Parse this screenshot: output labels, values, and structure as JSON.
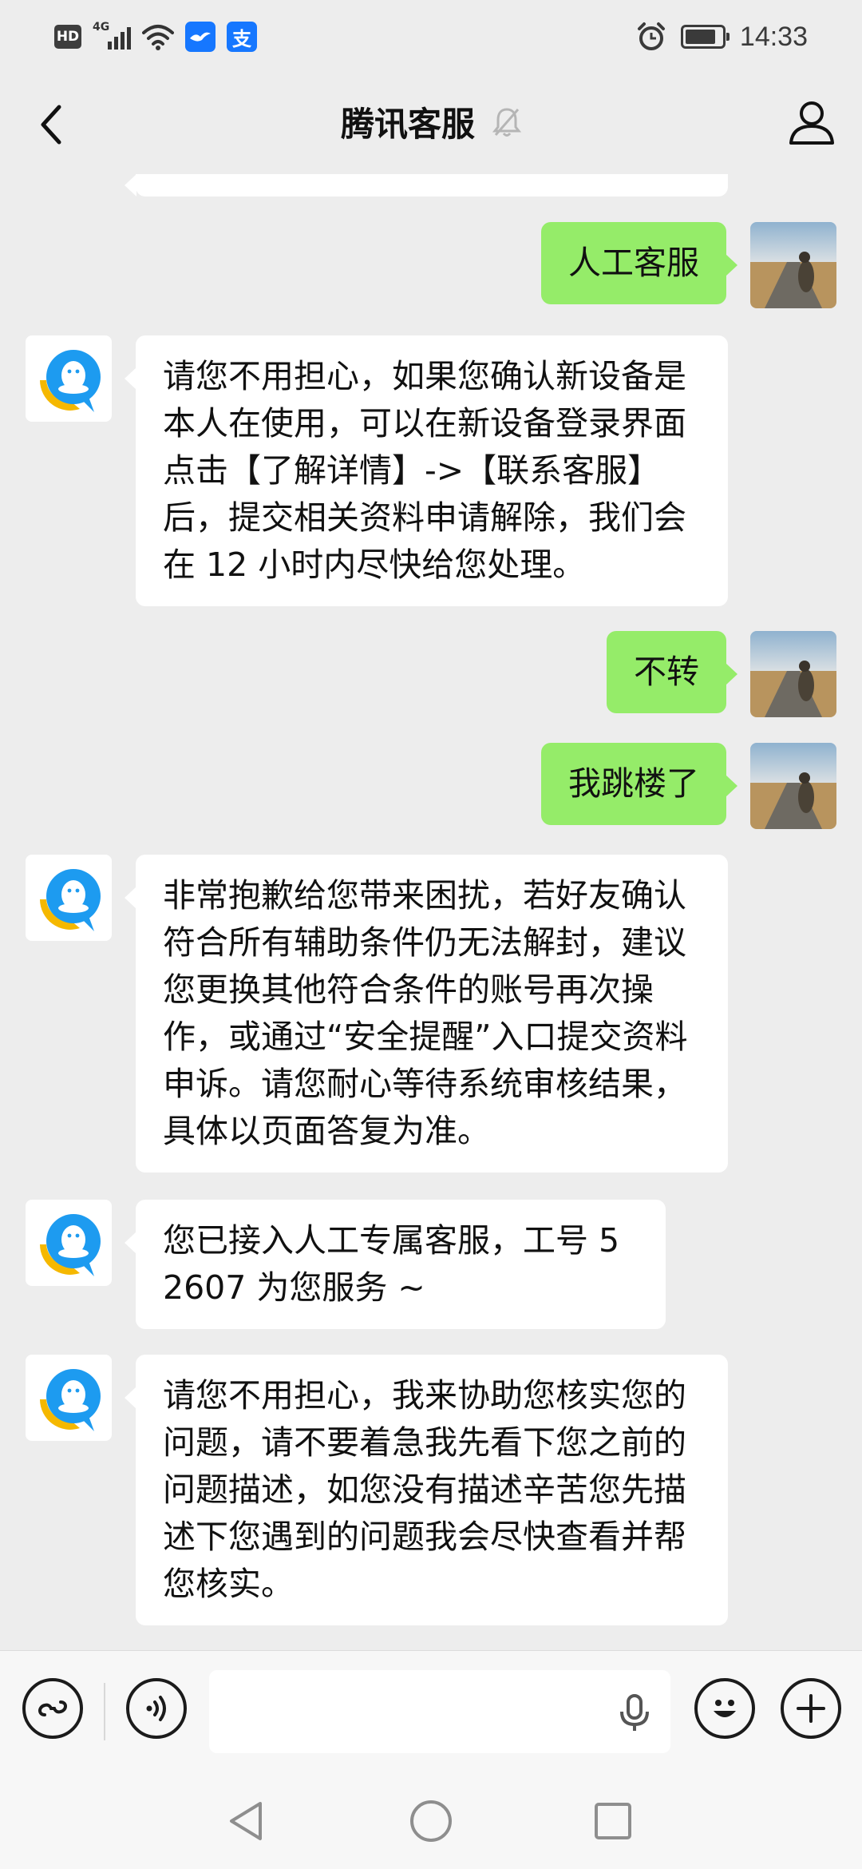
{
  "status_bar": {
    "hd_label": "HD",
    "network_label": "4G",
    "alipay_glyph": "支",
    "time": "14:33",
    "battery_level": 0.85,
    "icons": [
      "hd-icon",
      "signal-icon",
      "wifi-icon",
      "bird-app-icon",
      "alipay-icon",
      "alarm-icon",
      "battery-charging-icon"
    ]
  },
  "header": {
    "title": "腾讯客服",
    "muted": true,
    "icons": [
      "back-icon",
      "mute-bell-icon",
      "profile-icon"
    ]
  },
  "messages": [
    {
      "side": "incoming",
      "text": "",
      "partially_visible": true
    },
    {
      "side": "outgoing",
      "text": "人工客服"
    },
    {
      "side": "incoming",
      "text": "请您不用担心，如果您确认新设备是本人在使用，可以在新设备登录界面点击【了解详情】->【联系客服】后，提交相关资料申请解除，我们会在 12 小时内尽快给您处理。"
    },
    {
      "side": "outgoing",
      "text": "不转"
    },
    {
      "side": "outgoing",
      "text": "我跳楼了"
    },
    {
      "side": "incoming",
      "text": "非常抱歉给您带来困扰，若好友确认符合所有辅助条件仍无法解封，建议您更换其他符合条件的账号再次操作，或通过“安全提醒”入口提交资料申诉。请您耐心等待系统审核结果，具体以页面答复为准。"
    },
    {
      "side": "incoming",
      "text": "您已接入人工专属客服，工号 52607 为您服务 ~"
    },
    {
      "side": "incoming",
      "text": "请您不用担心，我来协助您核实您的问题，请不要着急我先看下您之前的问题描述，如您没有描述辛苦您先描述下您遇到的问题我会尽快查看并帮您核实。"
    }
  ],
  "input_bar": {
    "value": "",
    "placeholder": "",
    "icons": [
      "mini-program-icon",
      "voice-icon",
      "microphone-icon",
      "emoji-icon",
      "plus-icon"
    ]
  },
  "system_nav": {
    "icons": [
      "back-triangle-icon",
      "home-circle-icon",
      "recents-square-icon"
    ]
  },
  "colors": {
    "background": "#ededed",
    "outgoing_bubble": "#95ec69",
    "incoming_bubble": "#ffffff",
    "agent_avatar_blue": "#1d9bf0",
    "agent_avatar_yellow": "#f5b800"
  }
}
